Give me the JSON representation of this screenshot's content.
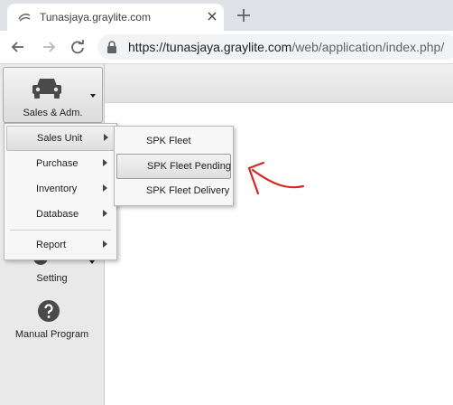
{
  "browser": {
    "tab_title": "Tunasjaya.graylite.com",
    "url_host": "https://tunasjaya.graylite.com",
    "url_path": "/web/application/index.php/",
    "icons": [
      "back-arrow-icon",
      "forward-arrow-icon",
      "reload-icon",
      "lock-icon",
      "close-icon",
      "plus-icon"
    ]
  },
  "sidebar": {
    "items": [
      {
        "label": "Sales & Adm.",
        "icon": "car-icon",
        "active": true
      },
      {
        "label": "Setting",
        "icon": "gear-icon"
      },
      {
        "label": "Manual Program",
        "icon": "question-icon"
      }
    ]
  },
  "menu": {
    "items": [
      {
        "label": "Sales Unit",
        "has_submenu": true,
        "selected": true
      },
      {
        "label": "Purchase",
        "has_submenu": true
      },
      {
        "label": "Inventory",
        "has_submenu": true
      },
      {
        "label": "Database",
        "has_submenu": true
      },
      {
        "label": "Report",
        "has_submenu": true
      }
    ]
  },
  "submenu": {
    "items": [
      {
        "label": "SPK Fleet"
      },
      {
        "label": "SPK Fleet Pending",
        "hover": true
      },
      {
        "label": "SPK Fleet Delivery"
      }
    ]
  },
  "colors": {
    "tabstrip": "#dee1e6",
    "sidebar": "#e9e9e9",
    "annotation": "#d7261e",
    "icon_dark": "#4a4a4a"
  }
}
